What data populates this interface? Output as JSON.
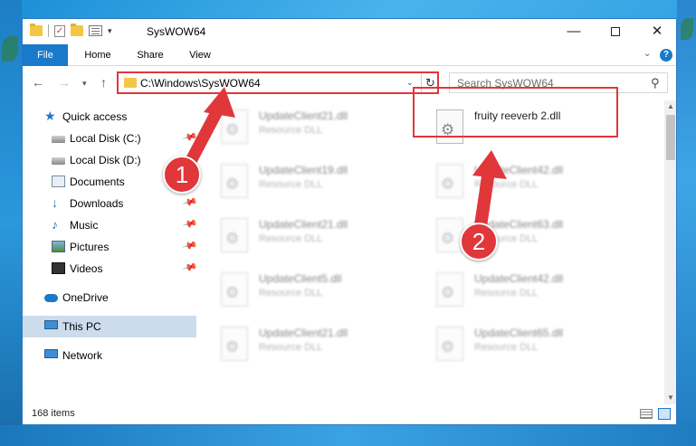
{
  "window": {
    "title": "SysWOW64",
    "minimize_glyph": "—",
    "close_glyph": "✕"
  },
  "ribbon": {
    "tabs": [
      "File",
      "Home",
      "Share",
      "View"
    ],
    "help_glyph": "?"
  },
  "address_bar": {
    "path": "C:\\Windows\\SysWOW64",
    "search_placeholder": "Search SysWOW64"
  },
  "sidebar": {
    "items": [
      {
        "label": "Quick access",
        "icon": "star-icon",
        "pinned": false
      },
      {
        "label": "Local Disk (C:)",
        "icon": "drive-icon",
        "pinned": true
      },
      {
        "label": "Local Disk (D:)",
        "icon": "drive-icon",
        "pinned": false
      },
      {
        "label": "Documents",
        "icon": "documents-icon",
        "pinned": true
      },
      {
        "label": "Downloads",
        "icon": "download-icon",
        "pinned": true
      },
      {
        "label": "Music",
        "icon": "music-icon",
        "pinned": true
      },
      {
        "label": "Pictures",
        "icon": "pictures-icon",
        "pinned": true
      },
      {
        "label": "Videos",
        "icon": "videos-icon",
        "pinned": true
      },
      {
        "label": "OneDrive",
        "icon": "cloud-icon",
        "pinned": false
      },
      {
        "label": "This PC",
        "icon": "computer-icon",
        "pinned": false,
        "selected": true
      },
      {
        "label": "Network",
        "icon": "network-icon",
        "pinned": false
      }
    ]
  },
  "files": [
    {
      "name": "UpdateClient21.dll",
      "type": "Resource DLL"
    },
    {
      "name": "fruity reeverb 2.dll",
      "type": "",
      "highlighted": true
    },
    {
      "name": "UpdateClient19.dll",
      "type": "Resource DLL"
    },
    {
      "name": "UpdateClient42.dll",
      "type": "Resource DLL"
    },
    {
      "name": "UpdateClient21.dll",
      "type": "Resource DLL"
    },
    {
      "name": "UpdateClient63.dll",
      "type": "Resource DLL"
    },
    {
      "name": "UpdateClient5.dll",
      "type": "Resource DLL"
    },
    {
      "name": "UpdateClient42.dll",
      "type": "Resource DLL"
    },
    {
      "name": "UpdateClient21.dll",
      "type": "Resource DLL"
    },
    {
      "name": "UpdateClient65.dll",
      "type": "Resource DLL"
    }
  ],
  "status": {
    "item_count": "168 items"
  },
  "annotations": {
    "step1": "1",
    "step2": "2",
    "color": "#e0373b"
  }
}
